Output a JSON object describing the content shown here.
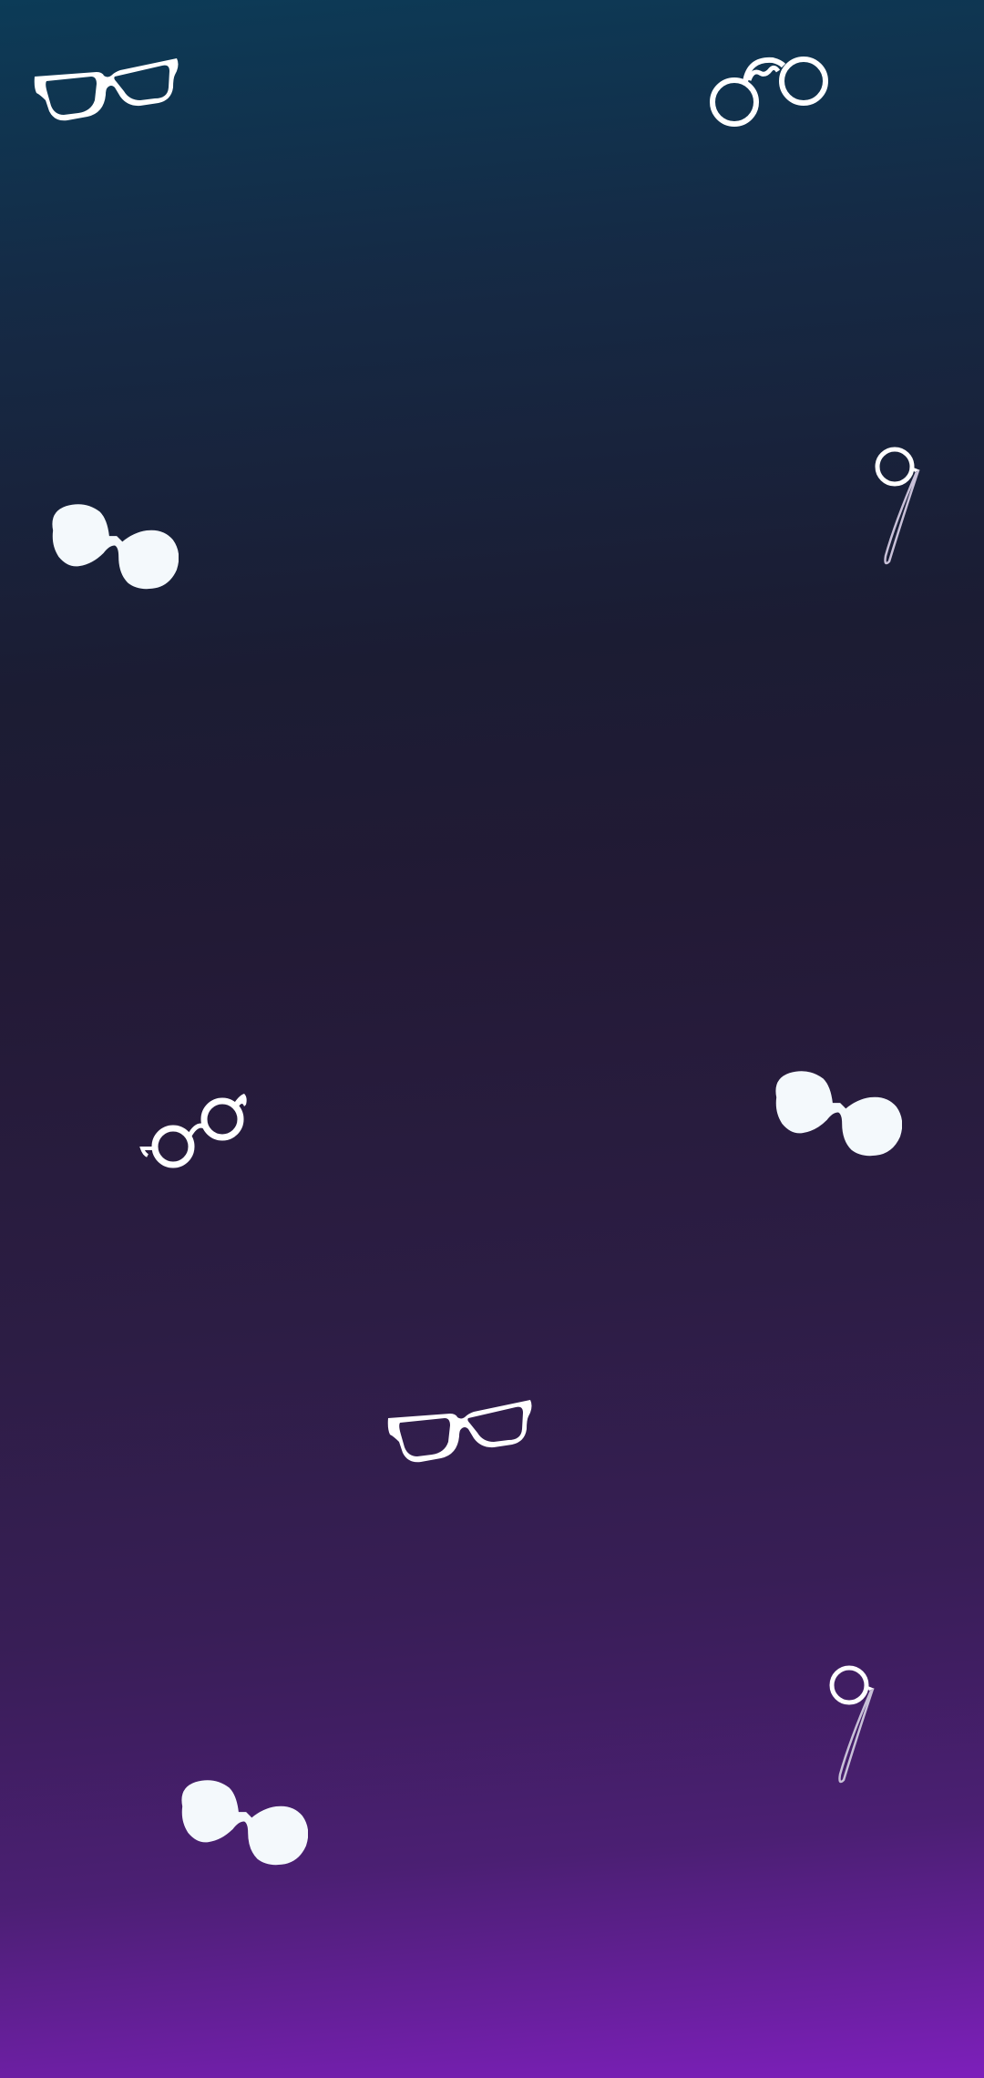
{
  "wallpaper": {
    "colors": {
      "gradient_top": "#0c3b57",
      "gradient_upper": "#152a45",
      "gradient_mid": "#221a35",
      "gradient_lower": "#381e56",
      "gradient_bottom": "#7d1fbb",
      "icon_color": "#ffffff",
      "sunglasses_color": "#f4f9fc"
    },
    "icons": [
      {
        "name": "wayfarer-glasses-icon"
      },
      {
        "name": "pince-nez-icon"
      },
      {
        "name": "round-sunglasses-icon"
      },
      {
        "name": "monocle-icon"
      },
      {
        "name": "round-glasses-icon"
      },
      {
        "name": "round-sunglasses-icon"
      },
      {
        "name": "wayfarer-glasses-icon"
      },
      {
        "name": "monocle-icon"
      },
      {
        "name": "round-sunglasses-icon"
      }
    ]
  }
}
